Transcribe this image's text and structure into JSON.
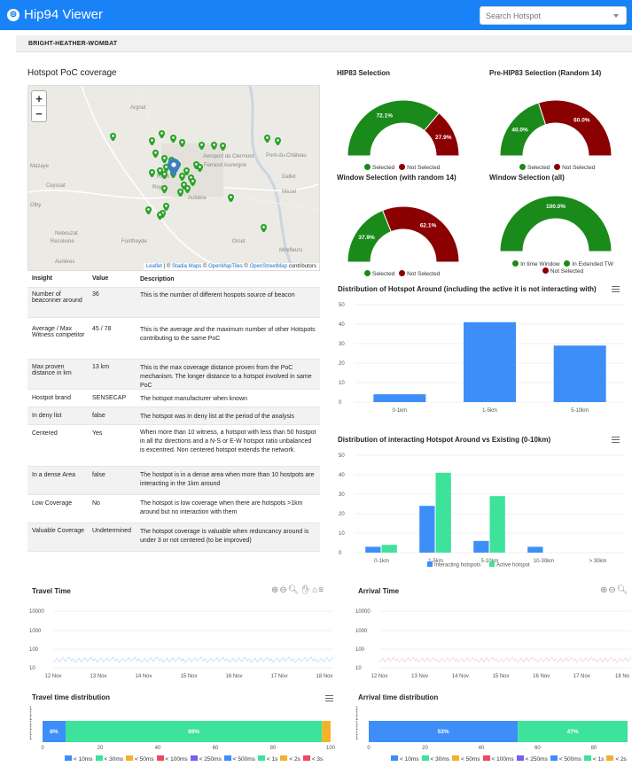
{
  "app": {
    "title": "Hip94 Viewer",
    "search_placeholder": "Search Hotspot"
  },
  "hotspot_name": "BRIGHT-HEATHER-WOMBAT",
  "map": {
    "title": "Hotspot PoC coverage",
    "zoom_in": "+",
    "zoom_out": "−",
    "place_labels": [
      "Argnat",
      "Pont-du-Château",
      "Aéroport de Clermont",
      "Ferrand Auvergne",
      "Riom",
      "Royat",
      "Aubière",
      "Dallet",
      "Mezel",
      "Nebouzat",
      "Recoleine",
      "Fontfreyde",
      "Orcet",
      "Mirefleurs",
      "Aurières",
      "Ceyssat",
      "Olby",
      "Mazaye"
    ],
    "attribution": {
      "leaflet": "Leaflet",
      "sep1": " | © ",
      "stadia": "Stadia Maps",
      "sep2": " © ",
      "omt": "OpenMapTiles",
      "sep3": " © ",
      "osm": "OpenStreetMap",
      "suffix": " contributors"
    }
  },
  "table": {
    "headers": [
      "Insight",
      "Value",
      "Description"
    ],
    "rows": [
      {
        "insight": "Number of beaconner around",
        "value": "36",
        "description": "This is the number of different hospots source of beacon"
      },
      {
        "insight": "Average / Max Witness competitor",
        "value": "45 / 78",
        "description": "This is the average and the maximum number of other Hotspots contributing to the same PoC"
      },
      {
        "insight": "Max proven distance in km",
        "value": "13 km",
        "description": "This is the max coverage distance proven from the PoC mechanism. The longer distance to a hotspot involved in same PoC"
      },
      {
        "insight": "Hostpot brand",
        "value": "SENSECAP",
        "description": "The hotspot manufacturer when known"
      },
      {
        "insight": "In deny list",
        "value": "false",
        "description": "The hotspot was in deny list at the period of the analysis"
      },
      {
        "insight": "Centered",
        "value": "Yes",
        "description": "When more than 10 witness, a hotspot with less than 50 hostpot in all thz directions and a N-S or E-W hotspot ratio unbalanced is excentred. Non centered hotspot extends the network."
      },
      {
        "insight": "In a dense Area",
        "value": "false",
        "description": "The hostpot is in a dense area when more than 10 hostpots are interacting in the 1km around"
      },
      {
        "insight": "Low Coverage",
        "value": "No",
        "description": "The hotspot is low coverage when there are hotspots >1km around but no interaction with them"
      },
      {
        "insight": "Valuable Coverage",
        "value": "Undetermined",
        "description": "The hotspot coverage is valuable when reduncancy around is under 3 or not centered (to be improved)"
      }
    ]
  },
  "colors": {
    "green": "#1a8a1a",
    "red": "#8b0000",
    "blue": "#3d8ef8",
    "teal": "#3de39a",
    "orange": "#f6b12b",
    "pink": "#e97ec9"
  },
  "gauges": [
    {
      "title": "HIP83 Selection",
      "slices": [
        {
          "label": "72.1%",
          "value": 72.1
        },
        {
          "label": "27.9%",
          "value": 27.9
        }
      ],
      "legend": [
        "Selected",
        "Not Selected"
      ]
    },
    {
      "title": "Pre-HIP83 Selection (Random 14)",
      "slices": [
        {
          "label": "40.0%",
          "value": 40.0
        },
        {
          "label": "60.0%",
          "value": 60.0
        }
      ],
      "legend": [
        "Selected",
        "Not Selected"
      ]
    },
    {
      "title": "Window Selection (with random 14)",
      "slices": [
        {
          "label": "37.9%",
          "value": 37.9
        },
        {
          "label": "62.1%",
          "value": 62.1
        }
      ],
      "legend": [
        "Selected",
        "Not Selected"
      ]
    },
    {
      "title": "Window Selection (all)",
      "slices": [
        {
          "label": "100.0%",
          "value": 100.0
        }
      ],
      "legend": [
        "In time Window",
        "In Extended TW",
        "Not Selected"
      ]
    }
  ],
  "chart_data": [
    {
      "type": "bar",
      "title": "Distribution of Hotspot Around (including the active it is not interacting with)",
      "categories": [
        "0-1km",
        "1-5km",
        "5-10km"
      ],
      "values": [
        4,
        41,
        29
      ],
      "ylim": [
        0,
        50
      ],
      "yticks": [
        "0",
        "10",
        "20",
        "30",
        "40",
        "50"
      ]
    },
    {
      "type": "bar",
      "title": "Distribution of interacting Hotspot Around vs Existing (0-10km)",
      "categories": [
        "0-1km",
        "1-5km",
        "5-10km",
        "10-30km",
        "> 30km"
      ],
      "series": [
        {
          "name": "Interacting hotspots",
          "values": [
            3,
            24,
            6,
            3,
            0
          ]
        },
        {
          "name": "Active hotspot",
          "values": [
            4,
            41,
            29,
            0,
            0
          ]
        }
      ],
      "ylim": [
        0,
        50
      ],
      "yticks": [
        "0",
        "10",
        "20",
        "30",
        "40",
        "50"
      ]
    },
    {
      "type": "scatter",
      "title": "Travel Time",
      "x": [
        "12 Nov",
        "13 Nov",
        "14 Nov",
        "15 Nov",
        "16 Nov",
        "17 Nov",
        "18 Nov"
      ],
      "yticks": [
        "10",
        "100",
        "1000",
        "10000"
      ],
      "scale": "log"
    },
    {
      "type": "scatter",
      "title": "Arrival Time",
      "x": [
        "12 Nov",
        "13 Nov",
        "14 Nov",
        "15 Nov",
        "16 Nov",
        "17 Nov",
        "18 No"
      ],
      "yticks": [
        "10",
        "100",
        "1000",
        "10000"
      ],
      "scale": "log"
    },
    {
      "type": "bar",
      "title": "Travel time distribution",
      "segments": [
        {
          "label": "8%",
          "value": 8
        },
        {
          "label": "89%",
          "value": 89
        },
        {
          "label": "",
          "value": 3
        }
      ],
      "xticks": [
        "0",
        "20",
        "40",
        "60",
        "80",
        "100"
      ],
      "yticks": [
        "1",
        "1",
        "1",
        "1",
        "1",
        "1",
        "1"
      ]
    },
    {
      "type": "bar",
      "title": "Arrival time distribution",
      "segments": [
        {
          "label": "53%",
          "value": 53
        },
        {
          "label": "47%",
          "value": 47
        }
      ],
      "xticks": [
        "0",
        "20",
        "40",
        "60",
        "80"
      ],
      "yticks": [
        "1",
        "1",
        "1",
        "1",
        "1",
        "1",
        "1"
      ]
    }
  ],
  "time_legend": [
    "< 10ms",
    "< 30ms",
    "< 50ms",
    "< 100ms",
    "< 250ms",
    "< 500ms",
    "< 1s",
    "< 2s",
    "< 3s"
  ],
  "time_legend_right": [
    "< 10ms",
    "< 30ms",
    "< 50ms",
    "< 100ms",
    "< 250ms",
    "< 500ms",
    "< 1s",
    "< 2s"
  ],
  "time_legend_colors": [
    "#3d8ef8",
    "#3de39a",
    "#f6b12b",
    "#f2475f",
    "#7a5cf0",
    "#3d8ef8",
    "#3de39a",
    "#f6b12b",
    "#f2475f"
  ]
}
